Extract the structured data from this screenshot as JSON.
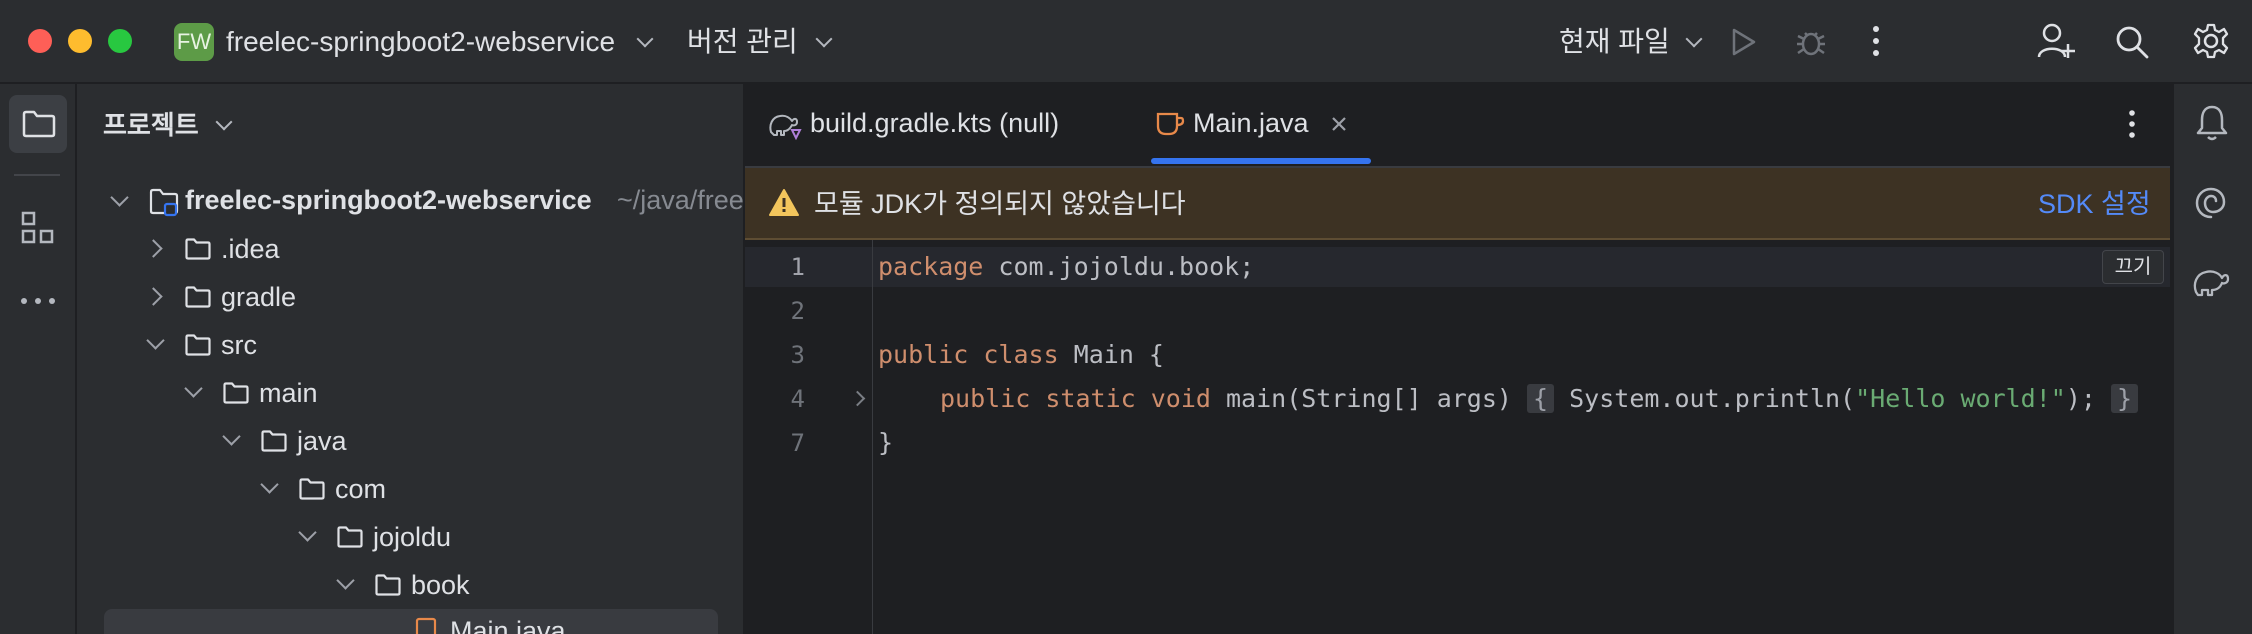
{
  "titlebar": {
    "project_badge": "FW",
    "project_name": "freelec-springboot2-webservice",
    "vcs_menu": "버전 관리",
    "run_config": "현재 파일"
  },
  "sidebar": {
    "title": "프로젝트"
  },
  "tree": {
    "root_name": "freelec-springboot2-webservice",
    "root_path": "~/java/free",
    "idea": ".idea",
    "gradle": "gradle",
    "src": "src",
    "main": "main",
    "java": "java",
    "com": "com",
    "jojoldu": "jojoldu",
    "book": "book",
    "main_java": "Main.java"
  },
  "tabs": {
    "tab1": "build.gradle.kts (null)",
    "tab2": "Main.java"
  },
  "banner": {
    "message": "모듈 JDK가 정의되지 않았습니다",
    "action": "SDK 설정"
  },
  "editor": {
    "inlay_hint": "끄기",
    "line_numbers": [
      "1",
      "2",
      "3",
      "4",
      "7"
    ],
    "line1_kw": "package",
    "line1_rest": " com.jojoldu.book;",
    "line3_kw": "public class",
    "line3_rest": " Main {",
    "line4_kw": "public static void",
    "line4_rest": " main(String[] args) ",
    "line4_fold_open": "{",
    "line4_body_pre": " System.out.println(",
    "line4_str": "\"Hello world!\"",
    "line4_body_post": "); ",
    "line4_fold_close": "}",
    "line7": "}"
  },
  "colors": {
    "accent": "#3574f0",
    "keyword": "#cf8e6d",
    "string": "#6aab73",
    "warning": "#f2c55c",
    "link": "#548af7"
  }
}
